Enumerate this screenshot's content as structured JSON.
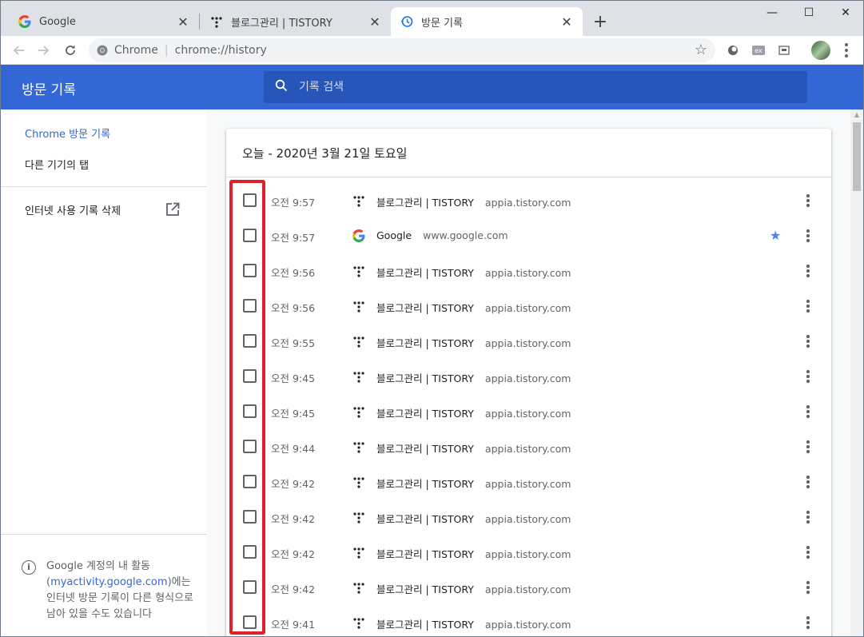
{
  "tabs": [
    {
      "title": "Google",
      "icon": "google-favicon"
    },
    {
      "title": "블로그관리 | TISTORY",
      "icon": "tistory-favicon"
    },
    {
      "title": "방문 기록",
      "icon": "history-icon"
    }
  ],
  "window_controls": {
    "minimize": "—",
    "maximize": "☐",
    "close": "✕"
  },
  "toolbar": {
    "site_label": "Chrome",
    "url": "chrome://history"
  },
  "header": {
    "title": "방문 기록",
    "search_placeholder": "기록 검색"
  },
  "sidebar": {
    "items": [
      {
        "label": "Chrome 방문 기록",
        "active": true
      },
      {
        "label": "다른 기기의 탭",
        "active": false
      }
    ],
    "clear_label": "인터넷 사용 기록 삭제",
    "note_prefix": "Google 계정의 내 활동 (",
    "note_link": "myactivity.google.com",
    "note_suffix": ")에는 인터넷 방문 기록이 다른 형식으로 남아 있을 수도 있습니다"
  },
  "history": {
    "date_heading": "오늘 - 2020년 3월 21일 토요일",
    "entries": [
      {
        "time": "오전 9:57",
        "title": "블로그관리 | TISTORY",
        "domain": "appia.tistory.com",
        "favicon": "tistory",
        "starred": false
      },
      {
        "time": "오전 9:57",
        "title": "Google",
        "domain": "www.google.com",
        "favicon": "google",
        "starred": true
      },
      {
        "time": "오전 9:56",
        "title": "블로그관리 | TISTORY",
        "domain": "appia.tistory.com",
        "favicon": "tistory",
        "starred": false
      },
      {
        "time": "오전 9:56",
        "title": "블로그관리 | TISTORY",
        "domain": "appia.tistory.com",
        "favicon": "tistory",
        "starred": false
      },
      {
        "time": "오전 9:55",
        "title": "블로그관리 | TISTORY",
        "domain": "appia.tistory.com",
        "favicon": "tistory",
        "starred": false
      },
      {
        "time": "오전 9:45",
        "title": "블로그관리 | TISTORY",
        "domain": "appia.tistory.com",
        "favicon": "tistory",
        "starred": false
      },
      {
        "time": "오전 9:45",
        "title": "블로그관리 | TISTORY",
        "domain": "appia.tistory.com",
        "favicon": "tistory",
        "starred": false
      },
      {
        "time": "오전 9:44",
        "title": "블로그관리 | TISTORY",
        "domain": "appia.tistory.com",
        "favicon": "tistory",
        "starred": false
      },
      {
        "time": "오전 9:42",
        "title": "블로그관리 | TISTORY",
        "domain": "appia.tistory.com",
        "favicon": "tistory",
        "starred": false
      },
      {
        "time": "오전 9:42",
        "title": "블로그관리 | TISTORY",
        "domain": "appia.tistory.com",
        "favicon": "tistory",
        "starred": false
      },
      {
        "time": "오전 9:42",
        "title": "블로그관리 | TISTORY",
        "domain": "appia.tistory.com",
        "favicon": "tistory",
        "starred": false
      },
      {
        "time": "오전 9:42",
        "title": "블로그관리 | TISTORY",
        "domain": "appia.tistory.com",
        "favicon": "tistory",
        "starred": false
      },
      {
        "time": "오전 9:41",
        "title": "블로그관리 | TISTORY",
        "domain": "appia.tistory.com",
        "favicon": "tistory",
        "starred": false
      }
    ]
  },
  "colors": {
    "header_blue": "#3367d6",
    "search_blue": "#2856b8",
    "highlight_red": "#e0202a",
    "star_blue": "#4285f4"
  }
}
